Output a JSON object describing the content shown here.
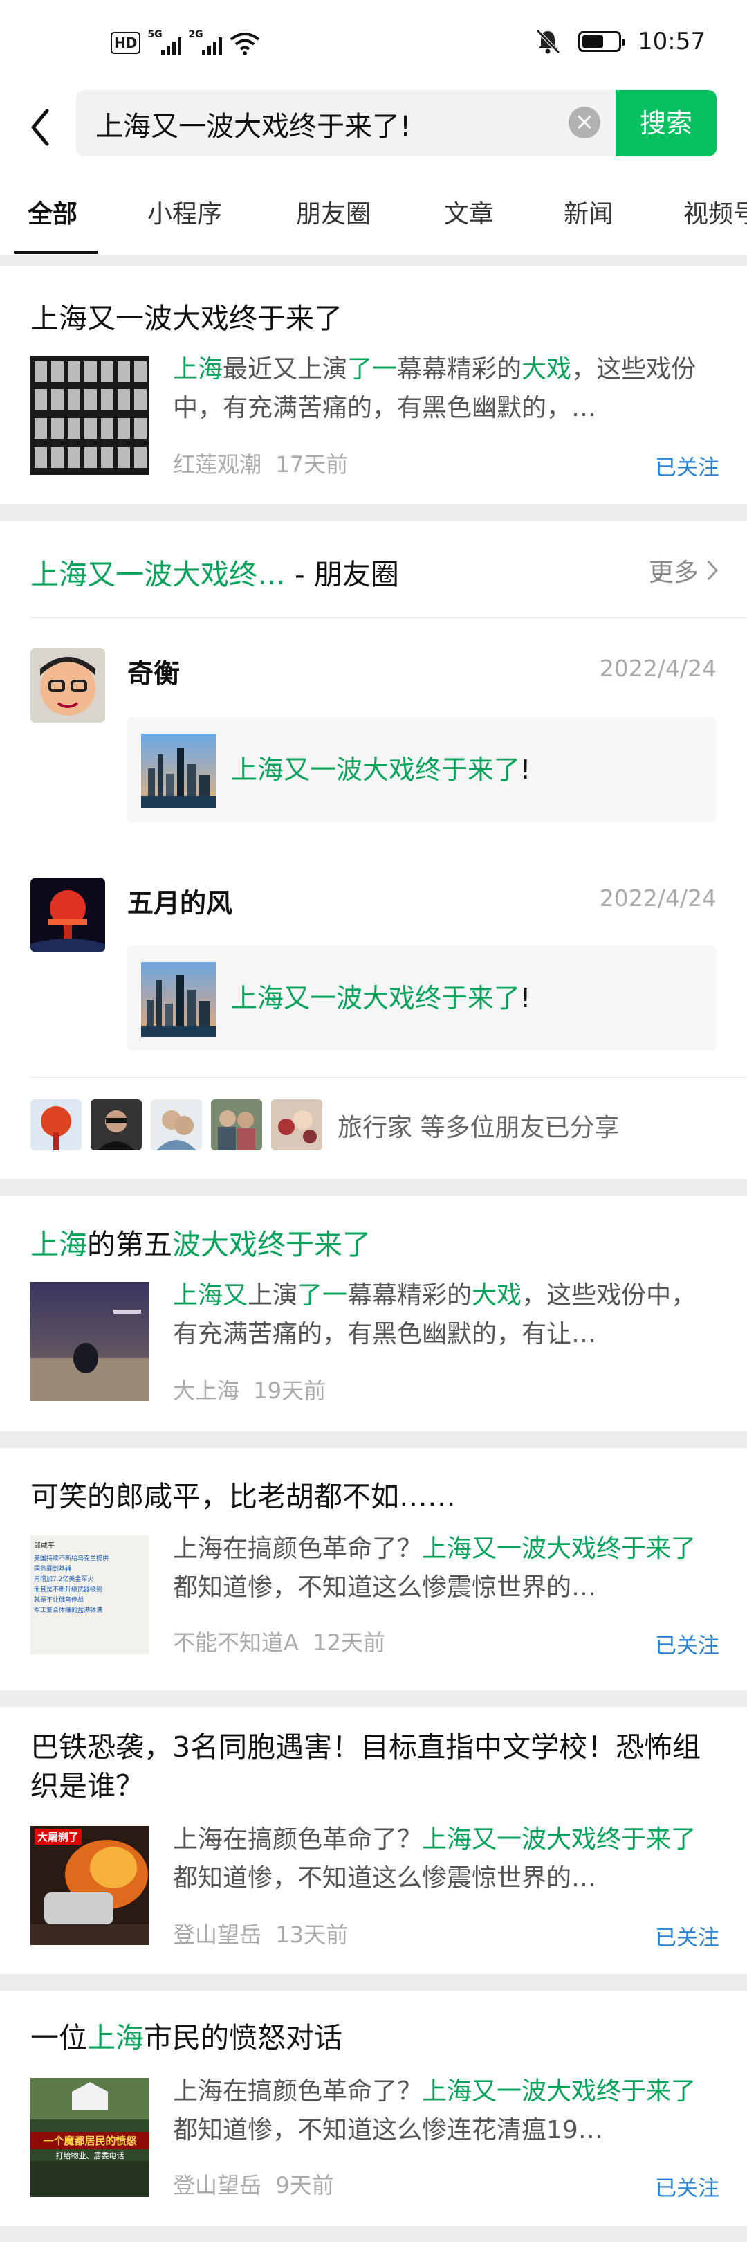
{
  "status_bar": {
    "hd": "HD",
    "signal1": "5G",
    "signal2": "2G",
    "time": "10:57",
    "battery_level": 0.6
  },
  "search": {
    "query": "上海又一波大戏终于来了!",
    "button": "搜索"
  },
  "tabs": [
    "全部",
    "小程序",
    "朋友圈",
    "文章",
    "新闻",
    "视频号"
  ],
  "results": [
    {
      "title": "上海又一波大戏终于来了",
      "snippet_parts": [
        "上海",
        "最近又上演",
        "了一",
        "幕幕精彩的",
        "大戏",
        "，这些戏份中，有充满苦痛的，有黑色幽默的，…"
      ],
      "source": "红莲观潮",
      "time": "17天前",
      "followed": "已关注"
    }
  ],
  "moments": {
    "heading_hl": "上海又一波大戏终…",
    "heading_rest": " - 朋友圈",
    "more": "更多",
    "posts": [
      {
        "name": "奇衡",
        "date": "2022/4/24",
        "text": "上海又一波大戏终于来了",
        "punct": "!"
      },
      {
        "name": "五月的风",
        "date": "2022/4/24",
        "text": "上海又一波大戏终于来了",
        "punct": "!"
      }
    ],
    "shared_by": "旅行家 等多位朋友已分享"
  },
  "articles": [
    {
      "title_parts": [
        "上海",
        "的第五",
        "波大戏终于来了"
      ],
      "snippet_parts": [
        "上海又",
        "上演",
        "了一",
        "幕幕精彩的",
        "大戏",
        "，这些戏份中，有充满苦痛的，有黑色幽默的，有让…"
      ],
      "source": "大上海",
      "time": "19天前",
      "followed": ""
    },
    {
      "title": "可笑的郎咸平，比老胡都不如……",
      "snippet_parts": [
        "上海在搞颜色革命了？",
        "上海又一波大戏终于来了",
        "都知道惨，不知道这么惨震惊世界的…"
      ],
      "source": "不能不知道A",
      "time": "12天前",
      "followed": "已关注",
      "thumb_lines": [
        "郎咸平",
        "美国持续不断给乌克兰提供",
        "国务卿到基辅",
        "再增加7.2亿美金军火",
        "而且是不断升级武器级别",
        "就是不让俄乌停战",
        "军工复合体赚的盆满钵满"
      ]
    },
    {
      "title": "巴铁恐袭，3名同胞遇害！目标直指中文学校！恐怖组织是谁？",
      "snippet_parts": [
        "上海在搞颜色革命了？",
        "上海又一波大戏终于来了",
        "都知道惨，不知道这么惨震惊世界的…"
      ],
      "source": "登山望岳",
      "time": "13天前",
      "followed": "已关注",
      "thumb_label": "大屠刹了"
    },
    {
      "title_parts": [
        "一位",
        "上海",
        "市民的愤怒对话"
      ],
      "snippet_parts": [
        "上海在搞颜色革命了？",
        "上海又一波大戏终于来了",
        "都知道惨，不知道这么惨连花清瘟19…"
      ],
      "source": "登山望岳",
      "time": "9天前",
      "followed": "已关注",
      "thumb_label": "一个魔都居民的愤怒",
      "thumb_label2": "打给物业、居委电话"
    }
  ]
}
